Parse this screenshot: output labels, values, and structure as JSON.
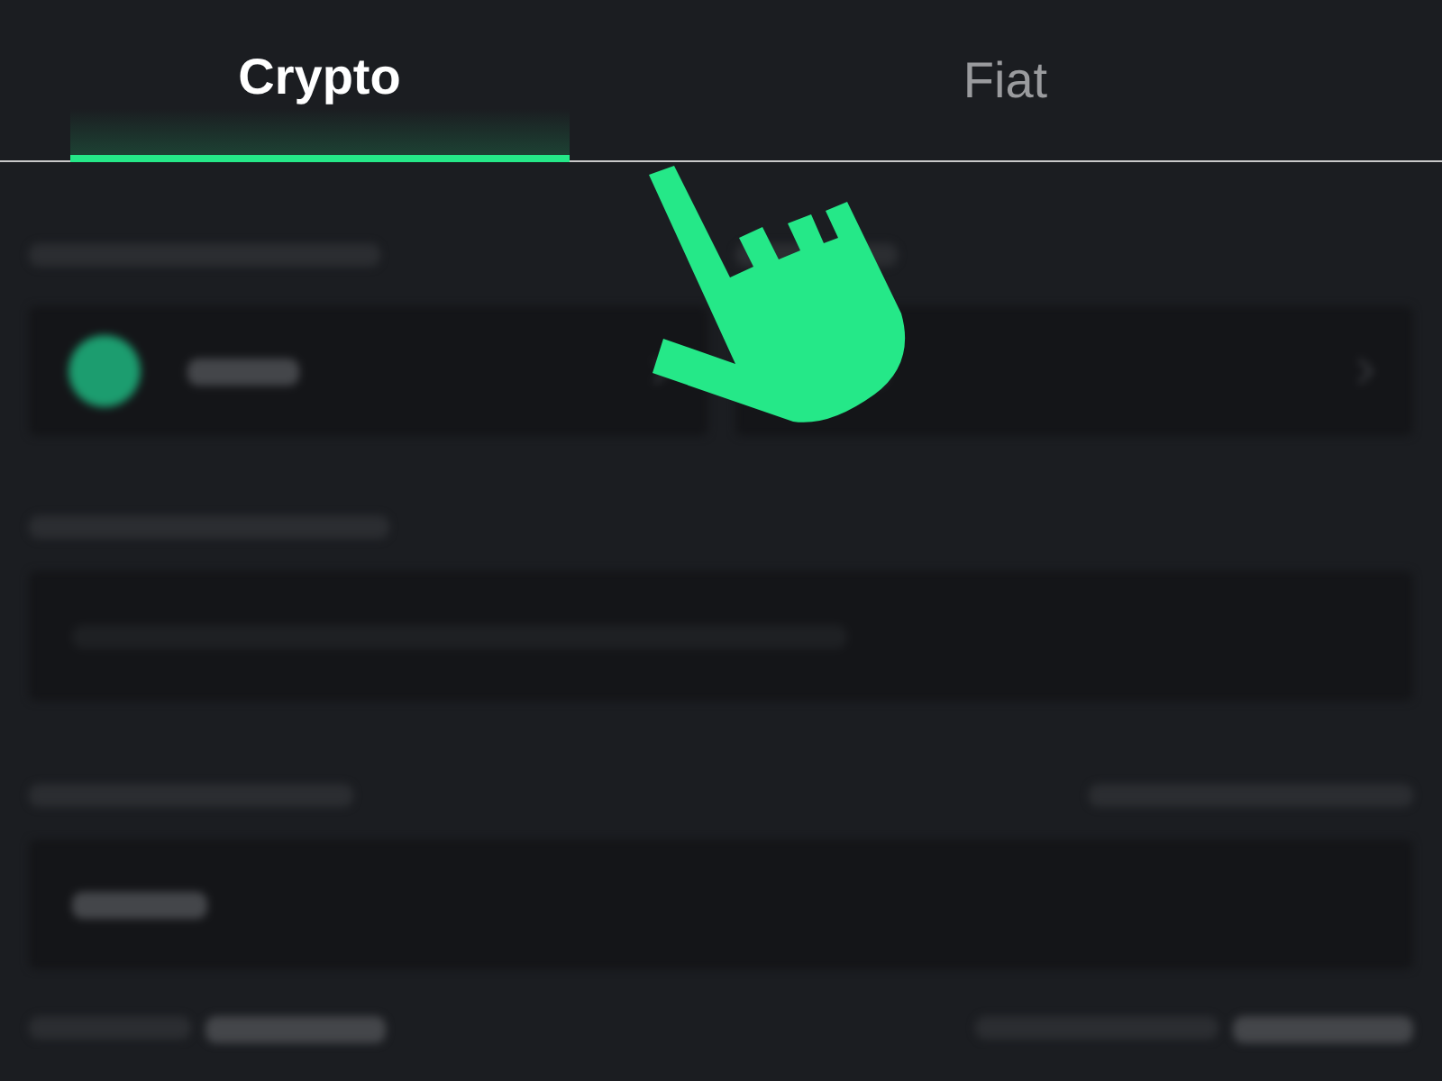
{
  "tabs": [
    {
      "label": "Crypto",
      "selected": true
    },
    {
      "label": "Fiat",
      "selected": false
    }
  ]
}
